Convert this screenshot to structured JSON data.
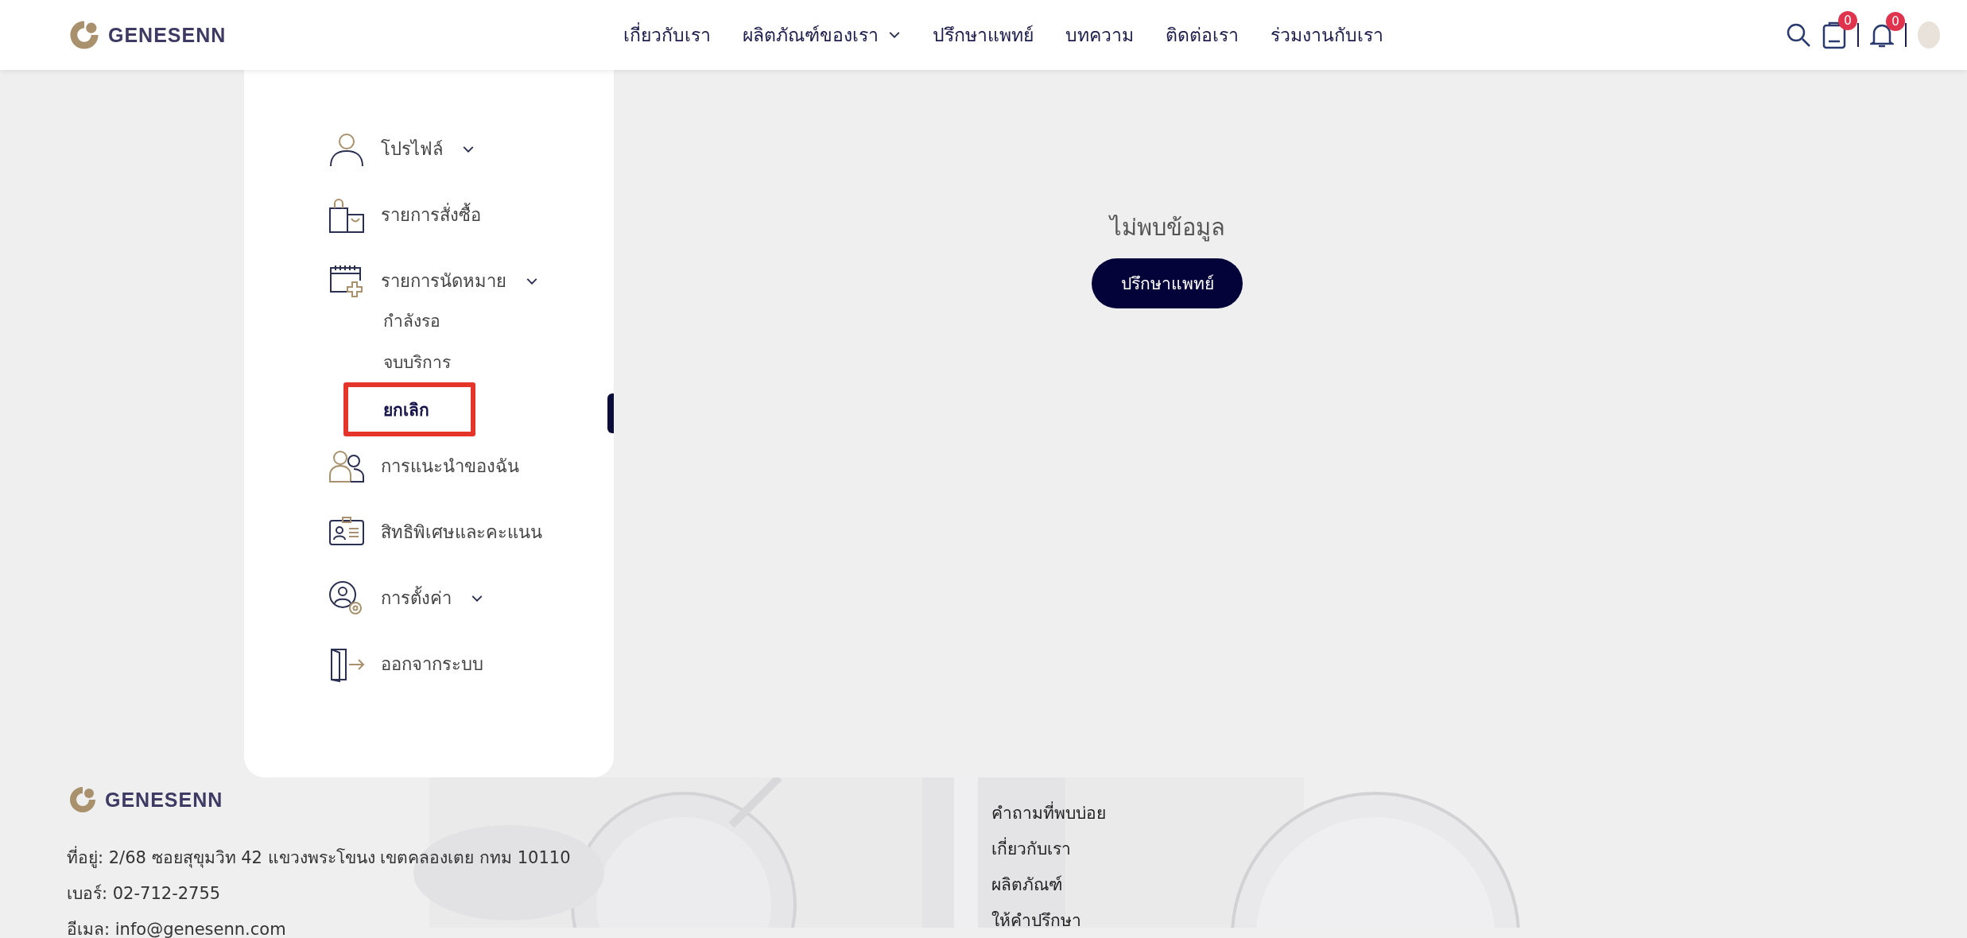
{
  "header": {
    "logo": "GENESENN",
    "nav": [
      {
        "label": "เกี่ยวกับเรา",
        "dropdown": false
      },
      {
        "label": "ผลิตภัณฑ์ของเรา",
        "dropdown": true
      },
      {
        "label": "ปรึกษาแพทย์",
        "dropdown": false
      },
      {
        "label": "บทความ",
        "dropdown": false
      },
      {
        "label": "ติดต่อเรา",
        "dropdown": false
      },
      {
        "label": "ร่วมงานกับเรา",
        "dropdown": false
      }
    ],
    "cart_badge": "0",
    "notification_badge": "0"
  },
  "sidebar": {
    "items": [
      {
        "kind": "profile",
        "label": "โปรไฟล์",
        "dropdown": true
      },
      {
        "kind": "orders",
        "label": "รายการสั่งซื้อ",
        "dropdown": false
      },
      {
        "kind": "appointments",
        "label": "รายการนัดหมาย",
        "dropdown": true,
        "children": [
          {
            "label": "กำลังรอ",
            "selected": false
          },
          {
            "label": "จบบริการ",
            "selected": false
          },
          {
            "label": "ยกเลิก",
            "selected": true
          }
        ]
      },
      {
        "kind": "referrals",
        "label": "การแนะนำของฉัน",
        "dropdown": false
      },
      {
        "kind": "privileges",
        "label": "สิทธิพิเศษและคะแนน",
        "dropdown": false
      },
      {
        "kind": "settings",
        "label": "การตั้งค่า",
        "dropdown": true
      },
      {
        "kind": "logout",
        "label": "ออกจากระบบ",
        "dropdown": false
      }
    ]
  },
  "content": {
    "message": "ไม่พบข้อมูล",
    "button": "ปรึกษาแพทย์"
  },
  "footer": {
    "logo": "GENESENN",
    "lines": [
      "ที่อยู่: 2/68 ซอยสุขุมวิท 42 แขวงพระโขนง เขตคลองเตย กทม 10110",
      "เบอร์: 02-712-2755",
      "อีเมล: info@genesenn.com"
    ],
    "links": [
      "คำถามที่พบบ่อย",
      "เกี่ยวกับเรา",
      "ผลิตภัณฑ์",
      "ให้คำปรึกษา"
    ]
  }
}
